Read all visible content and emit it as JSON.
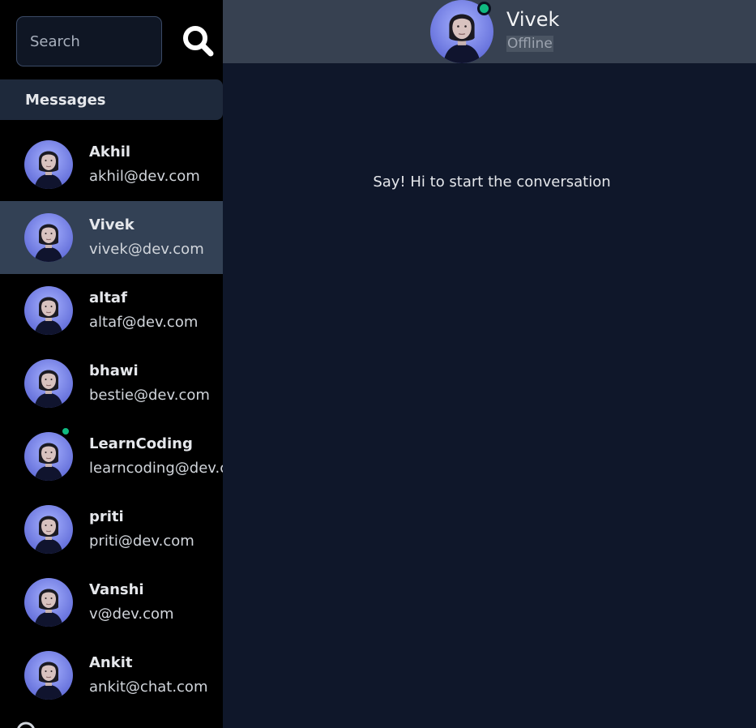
{
  "sidebar": {
    "search": {
      "placeholder": "Search"
    },
    "section_title": "Messages",
    "contacts": [
      {
        "name": "Akhil",
        "email": "akhil@dev.com",
        "online": false,
        "selected": false
      },
      {
        "name": "Vivek",
        "email": "vivek@dev.com",
        "online": false,
        "selected": true
      },
      {
        "name": "altaf",
        "email": "altaf@dev.com",
        "online": false,
        "selected": false
      },
      {
        "name": "bhawi",
        "email": "bestie@dev.com",
        "online": false,
        "selected": false
      },
      {
        "name": "LearnCoding",
        "email": "learncoding@dev.c",
        "online": true,
        "selected": false
      },
      {
        "name": "priti",
        "email": "priti@dev.com",
        "online": false,
        "selected": false
      },
      {
        "name": "Vanshi",
        "email": "v@dev.com",
        "online": false,
        "selected": false
      },
      {
        "name": "Ankit",
        "email": "ankit@chat.com",
        "online": false,
        "selected": false
      }
    ]
  },
  "chat": {
    "header": {
      "name": "Vivek",
      "status": "Offline"
    },
    "empty_message": "Say! Hi to start the conversation"
  },
  "colors": {
    "sidebar_bg": "#000000",
    "selected_bg": "#334155",
    "main_bg": "#0f172a",
    "header_bg": "#374151",
    "online": "#10b981"
  },
  "icons": {
    "search": "search-icon",
    "avatar": "avatar-image",
    "loading": "loading-spinner-icon"
  }
}
